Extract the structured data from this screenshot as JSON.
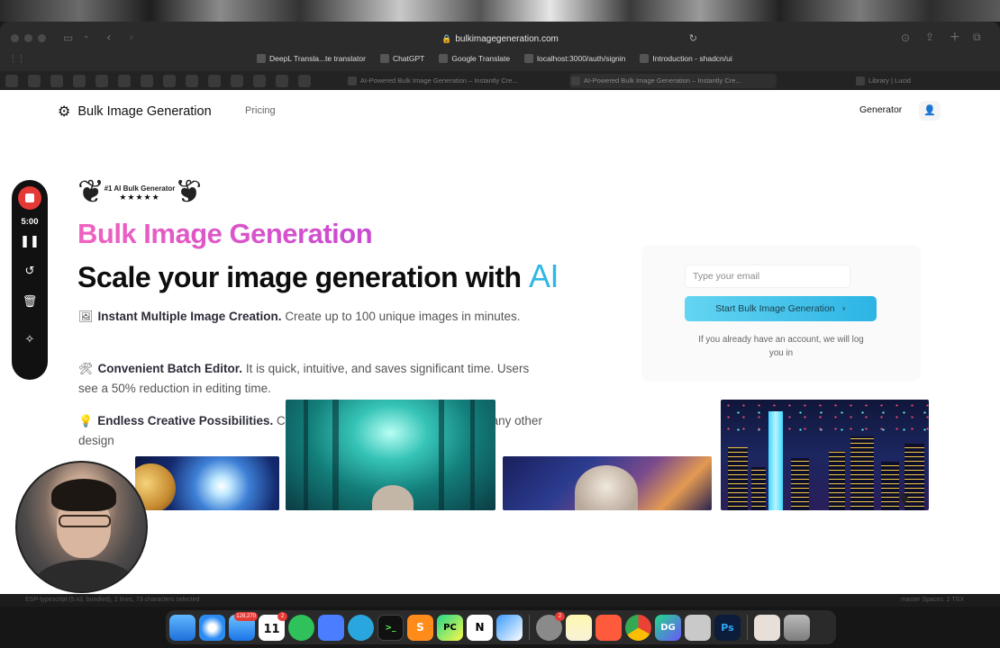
{
  "browser": {
    "url": "bulkimagegeneration.com",
    "bookmarks": [
      {
        "label": "DeepL Transla...te translator"
      },
      {
        "label": "ChatGPT"
      },
      {
        "label": "Google Translate"
      },
      {
        "label": "localhost:3000/auth/signin"
      },
      {
        "label": "Introduction - shadcn/ui"
      }
    ],
    "tabs": [
      {
        "label": "AI-Powered Bulk Image Generation – Instantly Cre..."
      },
      {
        "label": "AI-Powered Bulk Image Generation – Instantly Cre..."
      },
      {
        "label": "Library | Lucid"
      }
    ]
  },
  "nav": {
    "brand": "Bulk Image Generation",
    "pricing": "Pricing",
    "generator": "Generator"
  },
  "hero": {
    "badge_title": "#1 AI Bulk Generator",
    "badge_stars": "★★★★★",
    "title": "Bulk Image Generation",
    "subtitle": "Scale your image generation with",
    "subtitle_accent": "AI",
    "features": [
      {
        "icon": "🖼",
        "title": "Instant Multiple Image Creation.",
        "text": "Create up to 100 unique images in minutes."
      },
      {
        "icon": "🛠",
        "title": "Convenient Batch Editor.",
        "text": "It is quick, intuitive, and saves significant time. Users see a 50% reduction in editing time."
      },
      {
        "icon": "💡",
        "title": "Endless Creative Possibilities.",
        "text": "Create characters, book illustrations, or any other design"
      }
    ]
  },
  "signup": {
    "email_placeholder": "Type your email",
    "button": "Start Bulk Image Generation",
    "note": "If you already have an account, we will log you in"
  },
  "recorder": {
    "time": "5:00"
  },
  "statusbar": {
    "left": "ESP-typescript (5.x3, bundled), 2 lines, 73 characters selected",
    "right": "master    Spaces: 2    TSX"
  },
  "dock": {
    "mail_badge": "128,270",
    "calendar_month": "JUN",
    "calendar_day": "11",
    "calendar_badge": "2",
    "settings_badge": "2"
  },
  "colors": {
    "title_gradient_start": "#f062c0",
    "title_gradient_end": "#c84ad2",
    "ai_accent": "#2fb8e6",
    "button_start": "#64d4f2",
    "button_end": "#2cb4e4",
    "record_red": "#e53935"
  }
}
